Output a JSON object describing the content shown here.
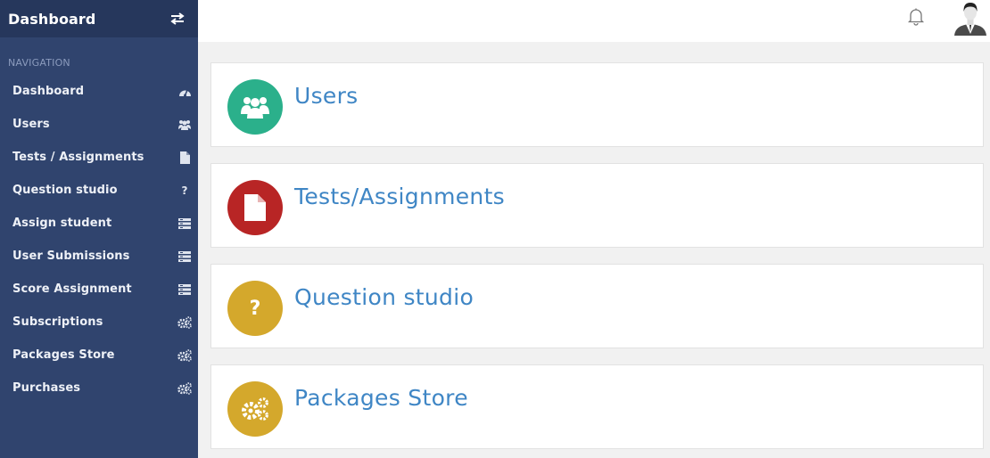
{
  "sidebar": {
    "brand": "Dashboard",
    "nav_heading": "NAVIGATION",
    "items": [
      {
        "label": "Dashboard",
        "icon": "dashboard-icon"
      },
      {
        "label": "Users",
        "icon": "users-icon"
      },
      {
        "label": "Tests / Assignments",
        "icon": "file-icon"
      },
      {
        "label": "Question studio",
        "icon": "question-icon",
        "glyph": "?"
      },
      {
        "label": "Assign student",
        "icon": "list-icon"
      },
      {
        "label": "User Submissions",
        "icon": "list-icon"
      },
      {
        "label": "Score Assignment",
        "icon": "list-icon"
      },
      {
        "label": "Subscriptions",
        "icon": "gears-icon"
      },
      {
        "label": "Packages Store",
        "icon": "gears-icon"
      },
      {
        "label": "Purchases",
        "icon": "gears-icon"
      }
    ]
  },
  "cards": [
    {
      "title": "Users",
      "icon": "users-icon",
      "color": "#2bb08b"
    },
    {
      "title": "Tests/Assignments",
      "icon": "file-icon",
      "color": "#b82525"
    },
    {
      "title": "Question studio",
      "icon": "question-icon",
      "glyph": "?",
      "color": "#d4a82c"
    },
    {
      "title": "Packages Store",
      "icon": "gears-icon",
      "color": "#d4a82c"
    }
  ],
  "colors": {
    "sidebar_bg": "#30446e",
    "sidebar_header_bg": "#26375c",
    "title_blue": "#3f86c5"
  }
}
